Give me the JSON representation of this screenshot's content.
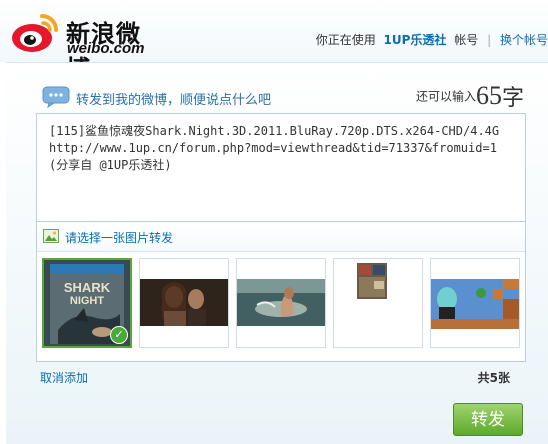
{
  "header": {
    "logo_cn": "新浪微博",
    "logo_en": "weibo.com",
    "using_prefix": "你正在使用",
    "username": "1UP乐透社",
    "account_label": "帐号",
    "switch_label": "换个帐号"
  },
  "compose": {
    "title": "转发到我的微博，顺便说点什么吧",
    "remain_label": "还可以输入",
    "remain_count": "65",
    "remain_unit": "字",
    "text": "[115]鲨鱼惊魂夜Shark.Night.3D.2011.BluRay.720p.DTS.x264-CHD/4.4G http://www.1up.cn/forum.php?mod=viewthread&tid=71337&fromuid=1 (分享自 @1UP乐透社)"
  },
  "picker": {
    "label": "请选择一张图片转发",
    "thumb_count": 5,
    "selected_index": 0,
    "cancel_label": "取消添加",
    "total_label": "共5张"
  },
  "actions": {
    "forward_label": "转发"
  },
  "icons": {
    "logo": "weibo-eye-icon",
    "bubble": "speech-bubble-icon",
    "picture": "picture-icon",
    "check": "check-icon"
  },
  "colors": {
    "link_blue": "#0a6eb4",
    "button_green": "#5da92b",
    "logo_red": "#e6162d",
    "logo_yellow": "#f5a623"
  }
}
